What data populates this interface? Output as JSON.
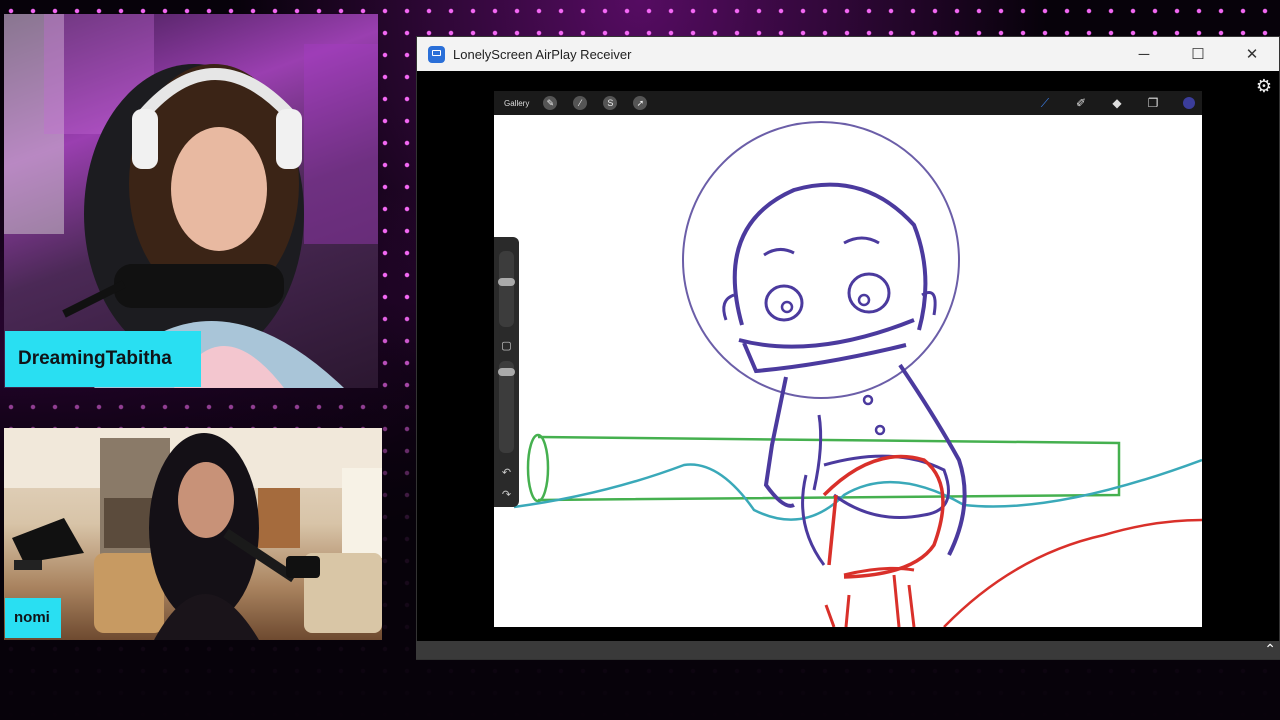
{
  "participants": {
    "host": {
      "name": "DreamingTabitha"
    },
    "guest": {
      "name": "nomi"
    }
  },
  "window": {
    "title": "LonelyScreen AirPlay Receiver",
    "app_icon": "airplay-screen-icon",
    "controls": {
      "minimize": "─",
      "maximize": "☐",
      "close": "✕"
    }
  },
  "procreate": {
    "gallery_label": "Gallery",
    "left_tools": [
      "wrench-icon",
      "magic-wand-icon",
      "selection-icon",
      "transform-icon"
    ],
    "right_tools": [
      "brush-icon",
      "smudge-icon",
      "eraser-icon",
      "layers-icon",
      "color-swatch-icon"
    ],
    "active_color": "#3b3d9a"
  },
  "colors": {
    "accent_cyan": "#29dff2",
    "stroke_purple": "#4b3a9e",
    "stroke_green": "#45b04f",
    "stroke_teal": "#3aa9b9",
    "stroke_red": "#d9302a"
  }
}
